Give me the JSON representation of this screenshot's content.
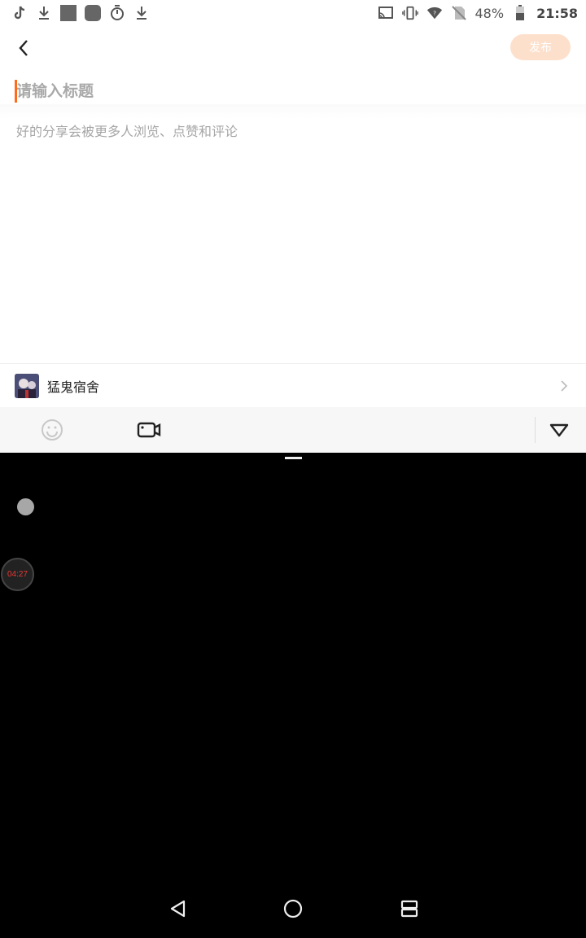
{
  "status_bar": {
    "left_icons": [
      "tiktok-icon",
      "download-icon",
      "square-icon",
      "rounded-square-icon",
      "stopwatch-icon",
      "download-icon"
    ],
    "right_icons": [
      "cast-icon",
      "vibrate-icon",
      "wifi-icon",
      "no-sim-icon",
      "battery-icon"
    ],
    "battery_percent": "48%",
    "time": "21:58"
  },
  "header": {
    "publish_label": "发布"
  },
  "editor": {
    "title_placeholder": "请输入标题",
    "body_placeholder": "好的分享会被更多人浏览、点赞和评论"
  },
  "topic": {
    "name": "猛鬼宿舍"
  },
  "toolbar": {
    "icons": [
      "emoji-icon",
      "video-icon",
      "collapse-icon"
    ]
  },
  "overlay": {
    "timer": "04:27"
  },
  "colors": {
    "accent": "#ff6b1a",
    "publish_disabled_bg": "#fde0cc",
    "timer_text": "#e53935"
  }
}
